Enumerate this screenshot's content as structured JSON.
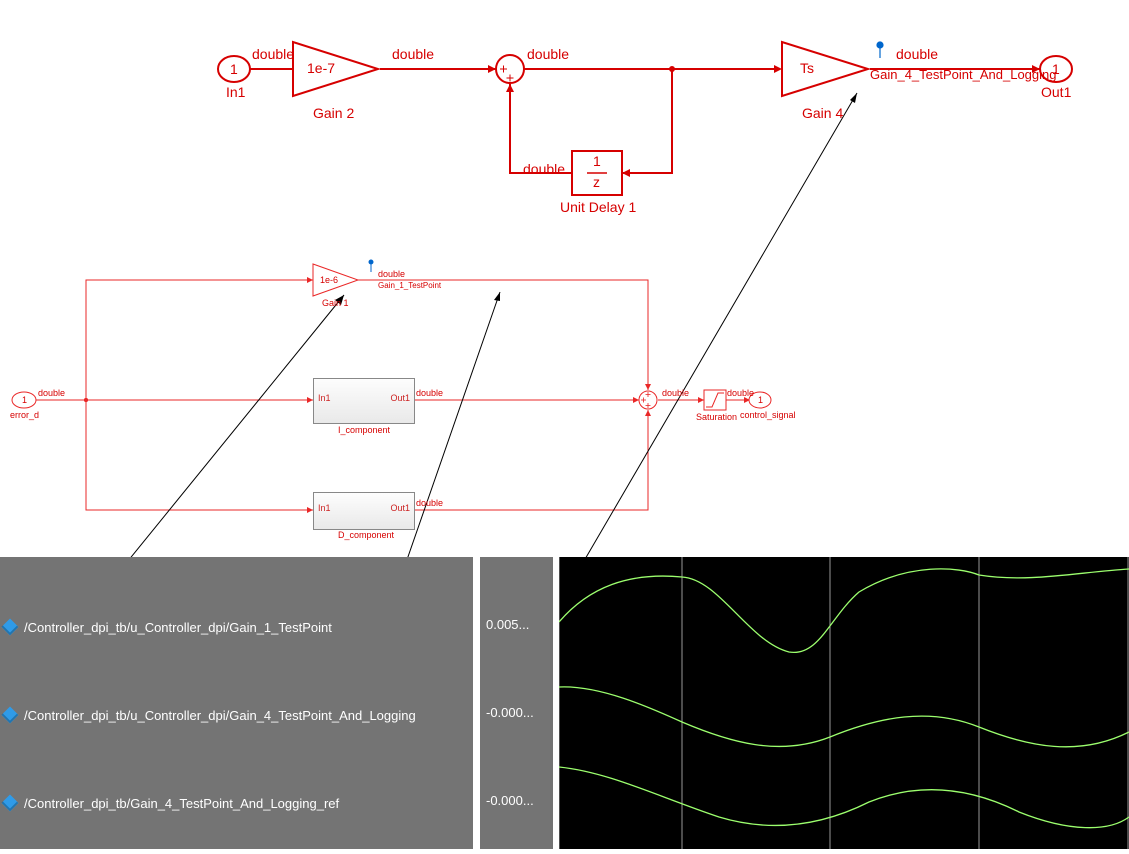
{
  "top_diagram": {
    "inport": {
      "num": "1",
      "name": "In1",
      "dtype": "double"
    },
    "gain2": {
      "label": "1e-7",
      "name": "Gain 2",
      "in_dtype": "double",
      "out_dtype": "double"
    },
    "sum": {
      "out_dtype": "double"
    },
    "unit_delay": {
      "num_top": "1",
      "num_bot": "z",
      "name": "Unit Delay 1",
      "in_dtype": "double"
    },
    "gain4": {
      "label": "Ts",
      "name": "Gain 4",
      "sig_name": "Gain_4_TestPoint_And_Logging",
      "out_dtype": "double"
    },
    "outport": {
      "num": "1",
      "name": "Out1"
    }
  },
  "mid_diagram": {
    "inport": {
      "num": "1",
      "name": "error_d",
      "dtype": "double"
    },
    "gain1": {
      "label": "1e-6",
      "name": "Gain 1",
      "sig_name": "Gain_1_TestPoint",
      "out_dtype": "double"
    },
    "i_comp": {
      "in": "In1",
      "out": "Out1",
      "name": "I_component",
      "out_dtype": "double"
    },
    "d_comp": {
      "in": "In1",
      "out": "Out1",
      "name": "D_component",
      "out_dtype": "double"
    },
    "sum": {
      "out_dtype": "double"
    },
    "sat": {
      "name": "Saturation",
      "out_dtype": "double"
    },
    "outport": {
      "num": "1",
      "name": "control_signal"
    }
  },
  "signals": [
    {
      "path": "/Controller_dpi_tb/u_Controller_dpi/Gain_1_TestPoint",
      "value": "0.005..."
    },
    {
      "path": "/Controller_dpi_tb/u_Controller_dpi/Gain_4_TestPoint_And_Logging",
      "value": "-0.000..."
    },
    {
      "path": "/Controller_dpi_tb/Gain_4_TestPoint_And_Logging_ref",
      "value": "-0.000..."
    }
  ]
}
